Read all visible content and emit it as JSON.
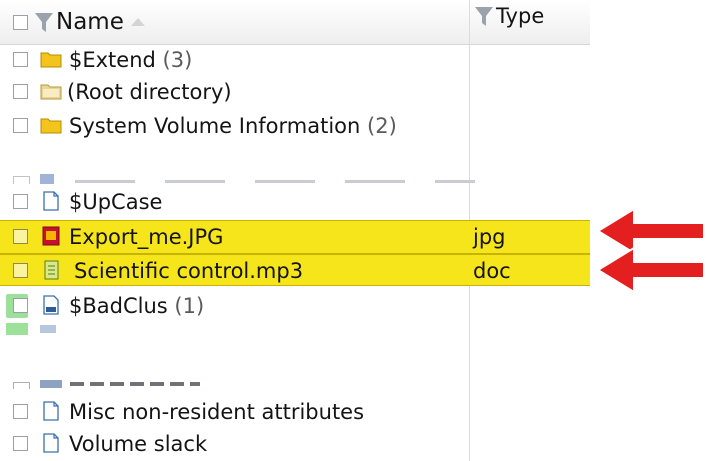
{
  "columns": {
    "name": "Name",
    "type": "Type"
  },
  "rows": [
    {
      "name": "$Extend",
      "count": "(3)",
      "type": "",
      "icon": "folder-icon"
    },
    {
      "name": "(Root directory)",
      "count": "",
      "type": "",
      "icon": "root-folder-icon"
    },
    {
      "name": "System Volume Information",
      "count": "(2)",
      "type": "",
      "icon": "folder-icon"
    },
    {
      "name": "$UpCase",
      "count": "",
      "type": "",
      "icon": "file-icon"
    },
    {
      "name": "Export_me.JPG",
      "count": "",
      "type": "jpg",
      "icon": "jpg-file-icon",
      "highlighted": true
    },
    {
      "name": "Scientific control.mp3",
      "count": "",
      "type": "doc",
      "icon": "doc-file-icon",
      "highlighted": true
    },
    {
      "name": "$BadClus",
      "count": "(1)",
      "type": "",
      "icon": "system-file-icon"
    },
    {
      "name": "Misc non-resident attributes",
      "count": "",
      "type": "",
      "icon": "file-icon"
    },
    {
      "name": "Volume slack",
      "count": "",
      "type": "",
      "icon": "file-icon"
    }
  ],
  "colors": {
    "highlight": "#f6e51b",
    "arrow": "#e41f1f",
    "folder": "#f2c41c"
  }
}
